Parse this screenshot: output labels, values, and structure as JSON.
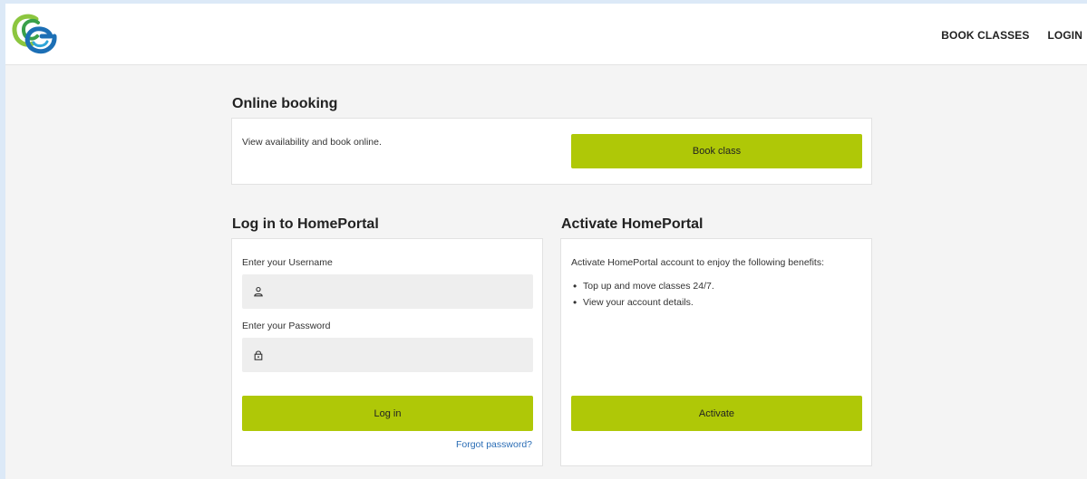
{
  "nav": {
    "book_classes": "BOOK CLASSES",
    "login": "LOGIN"
  },
  "online_booking": {
    "title": "Online booking",
    "description": "View availability and book online.",
    "button": "Book class"
  },
  "login_panel": {
    "title": "Log in to HomePortal",
    "username_label": "Enter your Username",
    "username_value": "",
    "password_label": "Enter your Password",
    "password_value": "",
    "button": "Log in",
    "forgot": "Forgot password?"
  },
  "activate_panel": {
    "title": "Activate HomePortal",
    "intro": "Activate HomePortal account to enjoy the following benefits:",
    "benefits": [
      "Top up and move classes 24/7.",
      "View your account details."
    ],
    "button": "Activate"
  },
  "colors": {
    "accent": "#afc807",
    "logo_green": "#8cc63f",
    "logo_blue": "#1c6fb5",
    "link": "#2a6db5"
  },
  "icons": {
    "username": "user-icon",
    "password": "lock-icon"
  }
}
